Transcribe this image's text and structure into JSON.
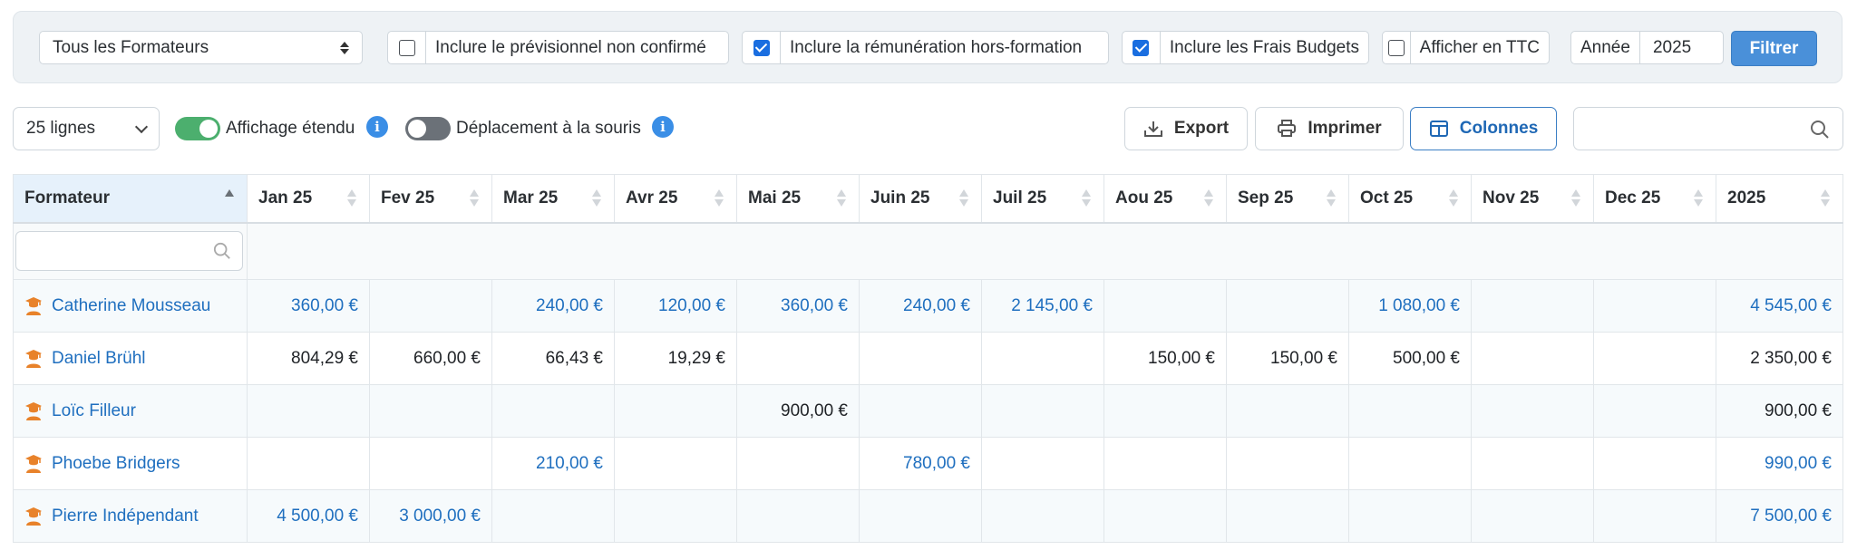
{
  "filters": {
    "trainer_select": "Tous les Formateurs",
    "checkboxes": [
      {
        "label": "Inclure le prévisionnel non confirmé",
        "checked": false
      },
      {
        "label": "Inclure la rémunération hors-formation",
        "checked": true
      },
      {
        "label": "Inclure les Frais Budgets",
        "checked": true
      },
      {
        "label": "Afficher en TTC",
        "checked": false
      }
    ],
    "year_label": "Année",
    "year_value": "2025",
    "filter_button": "Filtrer"
  },
  "toolbar": {
    "lines_select": "25 lignes",
    "extended_display_label": "Affichage étendu",
    "extended_display_on": true,
    "mouse_move_label": "Déplacement à la souris",
    "mouse_move_on": false,
    "info_glyph": "i",
    "export_label": "Export",
    "print_label": "Imprimer",
    "columns_label": "Colonnes",
    "search_value": ""
  },
  "table": {
    "columns": [
      "Formateur",
      "Jan 25",
      "Fev 25",
      "Mar 25",
      "Avr 25",
      "Mai 25",
      "Juin 25",
      "Juil 25",
      "Aou 25",
      "Sep 25",
      "Oct 25",
      "Nov 25",
      "Dec 25",
      "2025"
    ],
    "rows": [
      {
        "name": "Catherine Mousseau",
        "color": "blue",
        "cells": [
          "360,00 €",
          "",
          "240,00 €",
          "120,00 €",
          "360,00 €",
          "240,00 €",
          "2 145,00 €",
          "",
          "",
          "1 080,00 €",
          "",
          "",
          "4 545,00 €"
        ]
      },
      {
        "name": "Daniel Brühl",
        "color": "black",
        "cells": [
          "804,29 €",
          "660,00 €",
          "66,43 €",
          "19,29 €",
          "",
          "",
          "",
          "150,00 €",
          "150,00 €",
          "500,00 €",
          "",
          "",
          "2 350,00 €"
        ]
      },
      {
        "name": "Loïc Filleur",
        "color": "black",
        "cells": [
          "",
          "",
          "",
          "",
          "900,00 €",
          "",
          "",
          "",
          "",
          "",
          "",
          "",
          "900,00 €"
        ]
      },
      {
        "name": "Phoebe Bridgers",
        "color": "blue",
        "cells": [
          "",
          "",
          "210,00 €",
          "",
          "",
          "780,00 €",
          "",
          "",
          "",
          "",
          "",
          "",
          "990,00 €"
        ]
      },
      {
        "name": "Pierre Indépendant",
        "color": "blue",
        "cells": [
          "4 500,00 €",
          "3 000,00 €",
          "",
          "",
          "",
          "",
          "",
          "",
          "",
          "",
          "",
          "",
          "7 500,00 €"
        ]
      }
    ]
  },
  "colors": {
    "accent": "#4a90d9",
    "link": "#1f6fbf",
    "toggle_on": "#4caf6e",
    "trainer_icon": "#e8822a"
  },
  "icons": {
    "trainer": "graduate-icon",
    "search": "search-icon",
    "export": "download-icon",
    "print": "printer-icon",
    "columns": "columns-icon"
  }
}
